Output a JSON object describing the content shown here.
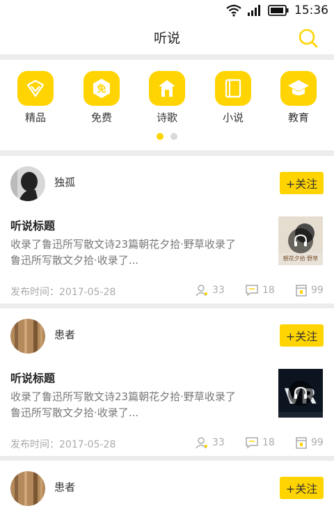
{
  "status_bar": {
    "time": "15:36"
  },
  "header": {
    "title": "听说"
  },
  "categories": [
    {
      "label": "精品",
      "icon": "diamond-icon"
    },
    {
      "label": "免费",
      "icon": "free-badge-icon",
      "badge": "免"
    },
    {
      "label": "诗歌",
      "icon": "house-icon"
    },
    {
      "label": "小说",
      "icon": "book-icon"
    },
    {
      "label": "教育",
      "icon": "graduation-cap-icon"
    }
  ],
  "carousel": {
    "pages": 2,
    "active": 1
  },
  "posts": [
    {
      "author": "独孤",
      "follow_label": "+关注",
      "title": "听说标题",
      "desc_line1": "收录了鲁迅所写散文诗23篇朝花夕拾·野草收录了",
      "desc_line2": "鲁迅所写散文夕拾·收录了...",
      "published": "发布时间：2017-05-28",
      "listeners": "33",
      "comments": "18",
      "gifts": "99",
      "thumb_caption": "朝花夕拾·野草"
    },
    {
      "author": "患者",
      "follow_label": "+关注",
      "title": "听说标题",
      "desc_line1": "收录了鲁迅所写散文诗23篇朝花夕拾·野草收录了",
      "desc_line2": "鲁迅所写散文夕拾·收录了...",
      "published": "发布时间：2017-05-28",
      "listeners": "33",
      "comments": "18",
      "gifts": "99",
      "thumb_caption": "VR"
    },
    {
      "author": "患者",
      "follow_label": "+关注"
    }
  ],
  "colors": {
    "accent": "#ffd400",
    "text": "#333333",
    "muted": "#aaaaaa",
    "background": "#ececec"
  }
}
